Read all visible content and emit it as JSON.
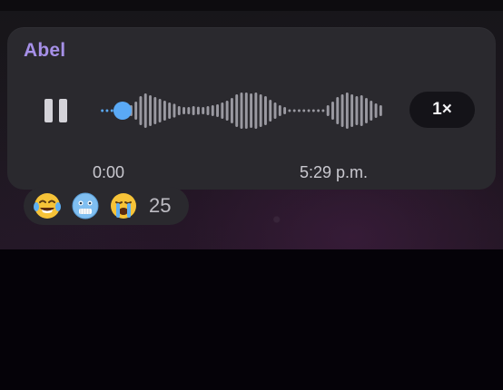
{
  "message": {
    "sender": "Abel",
    "type": "voice",
    "elapsed_time": "0:00",
    "timestamp": "5:29 p.m.",
    "playback_speed": "1×",
    "playback_progress": 0.08,
    "waveform_levels": [
      0.06,
      0.06,
      0.06,
      0.06,
      0.06,
      0.06,
      0.3,
      0.5,
      0.8,
      0.95,
      0.85,
      0.75,
      0.65,
      0.55,
      0.45,
      0.38,
      0.25,
      0.2,
      0.2,
      0.25,
      0.22,
      0.2,
      0.25,
      0.3,
      0.35,
      0.45,
      0.55,
      0.7,
      0.9,
      1.0,
      1.0,
      0.95,
      1.0,
      0.9,
      0.8,
      0.6,
      0.45,
      0.3,
      0.2,
      0.06,
      0.06,
      0.06,
      0.06,
      0.06,
      0.06,
      0.06,
      0.06,
      0.3,
      0.5,
      0.75,
      0.9,
      1.0,
      0.9,
      0.8,
      0.85,
      0.7,
      0.55,
      0.4,
      0.3
    ],
    "colors": {
      "sender": "#a690e8",
      "progress_dot": "#5aa9f5",
      "wave_played": "#5aa9f5",
      "wave_unplayed": "#9a99a1",
      "bubble": "#2a292e"
    }
  },
  "reactions": {
    "emojis": [
      {
        "name": "tears-of-joy-emoji",
        "glyph": "😂"
      },
      {
        "name": "cold-face-emoji",
        "glyph": "🥶"
      },
      {
        "name": "loudly-crying-emoji",
        "glyph": "😭"
      }
    ],
    "count": "25"
  },
  "icons": {
    "pause": "pause-icon"
  }
}
